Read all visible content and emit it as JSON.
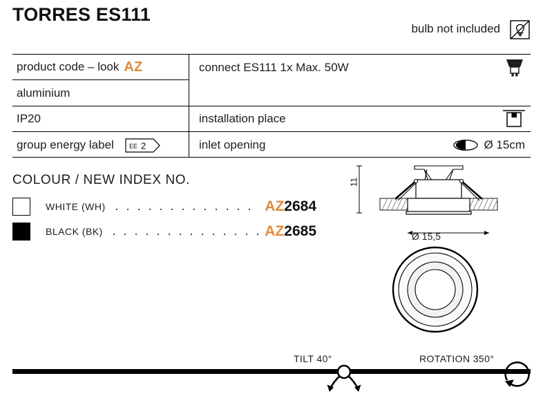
{
  "header": {
    "title": "TORRES ES111",
    "bulb_note": "bulb not included",
    "bulb_icon": "bulb-crossed-out-icon"
  },
  "spec_table": {
    "left_column": [
      {
        "label": "product code – look",
        "accent": "AZ",
        "badge": null
      },
      {
        "label": "aluminium",
        "accent": null,
        "badge": null
      },
      {
        "label": "IP20",
        "accent": null,
        "badge": null
      },
      {
        "label": "group energy label",
        "accent": null,
        "badge": {
          "prefix": "EE",
          "value": "2"
        }
      }
    ],
    "right_column": [
      {
        "label": "connect ES111 1x Max. 50W",
        "icon": "gu10-lamp-icon",
        "value": null
      },
      {
        "label": "",
        "icon": null,
        "value": null
      },
      {
        "label": "installation place",
        "icon": "recessed-ceiling-icon",
        "value": null
      },
      {
        "label": "inlet opening",
        "icon": "cutout-hole-icon",
        "value": "Ø 15cm"
      }
    ]
  },
  "colour_section": {
    "heading": "COLOUR / NEW INDEX NO.",
    "items": [
      {
        "swatch": "white",
        "name": "WHITE (WH)",
        "code_prefix": "AZ",
        "code_number": "2684"
      },
      {
        "swatch": "black",
        "name": "BLACK (BK)",
        "code_prefix": "AZ",
        "code_number": "2685"
      }
    ]
  },
  "drawings": {
    "side_view": {
      "height_label": "11",
      "diameter_label": "Ø 15,5",
      "name": "recessed-downlight-side-view"
    },
    "top_view": {
      "name": "recessed-downlight-top-view"
    }
  },
  "adjustment": {
    "tilt_label": "TILT 40°",
    "rotation_label": "ROTATION 350°",
    "tilt_icon": "tilt-arrows-icon",
    "rotation_icon": "rotation-arrow-icon"
  },
  "colors": {
    "accent_orange": "#E08A3C",
    "text_black": "#1d1d1d",
    "line_black": "#000000"
  }
}
